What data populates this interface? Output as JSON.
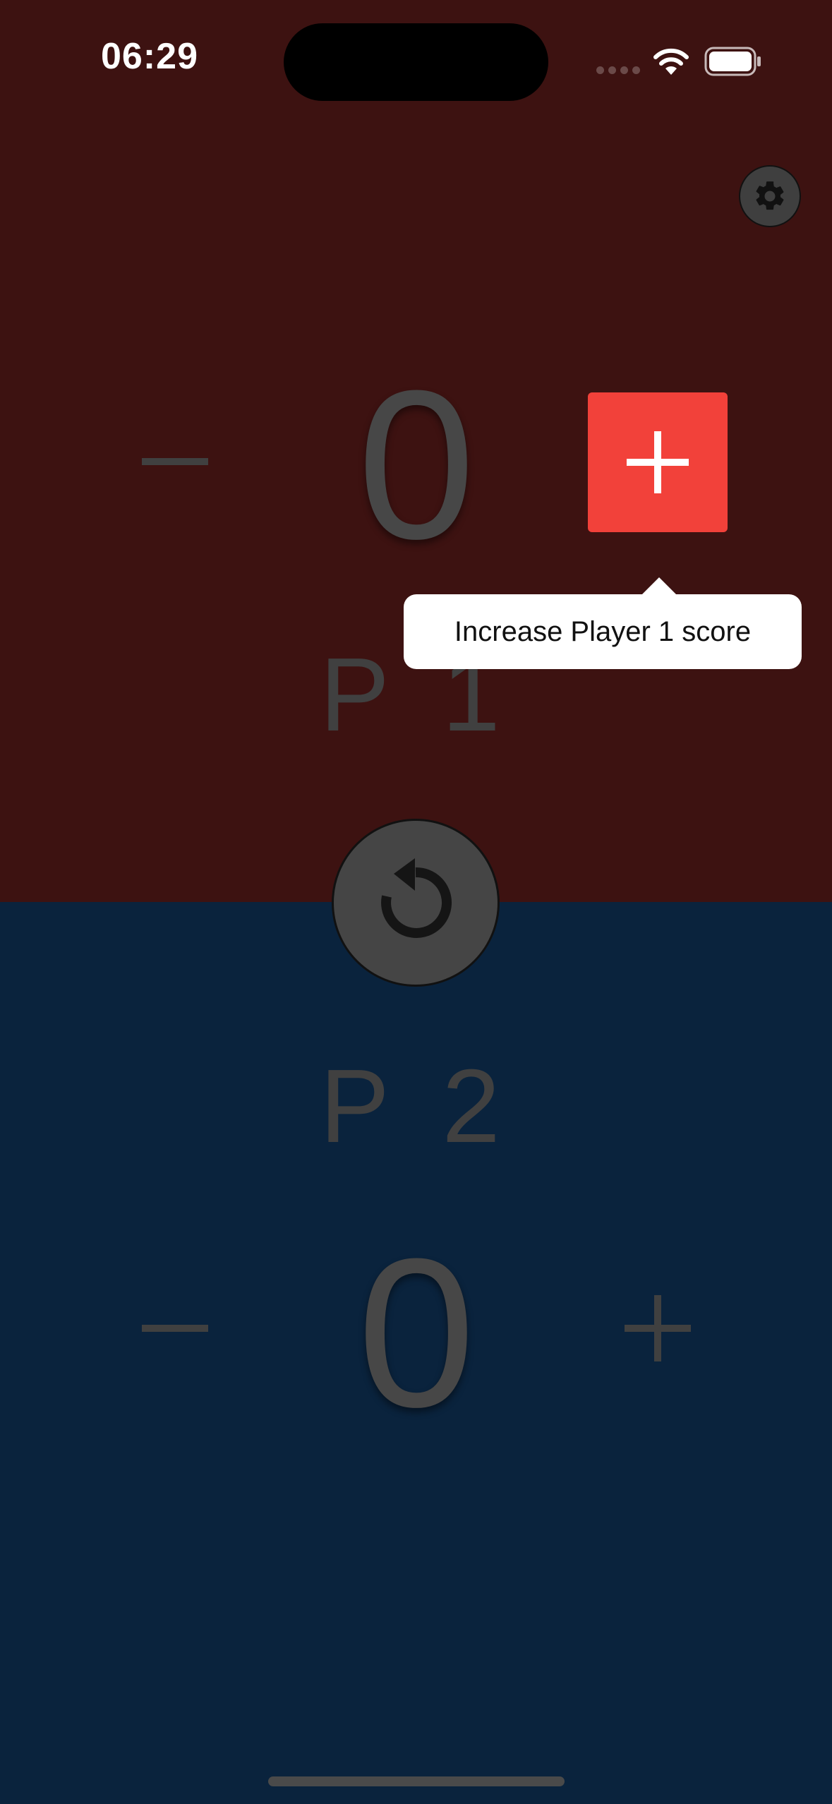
{
  "status_bar": {
    "time": "06:29"
  },
  "player1": {
    "label": "P 1",
    "score": "0",
    "color": "#3d1211"
  },
  "player2": {
    "label": "P 2",
    "score": "0",
    "color": "#0a233d"
  },
  "tooltip": {
    "text": "Increase Player 1 score"
  },
  "icons": {
    "settings": "gear-icon",
    "reset": "refresh-icon",
    "increase": "plus-icon",
    "decrease": "minus-icon"
  },
  "accent_color": "#f2413a"
}
